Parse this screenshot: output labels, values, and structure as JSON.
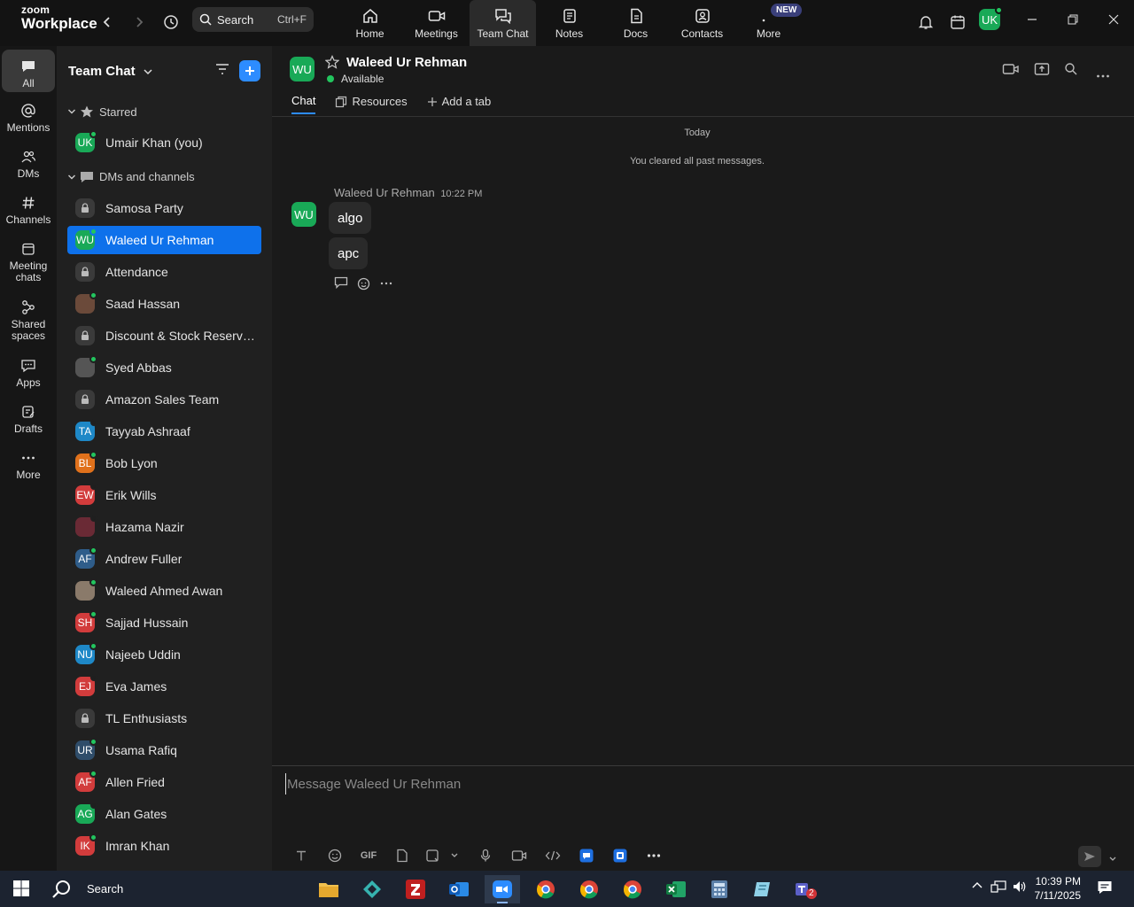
{
  "app": {
    "brand_top": "zoom",
    "brand_bottom": "Workplace"
  },
  "search": {
    "label": "Search",
    "shortcut": "Ctrl+F"
  },
  "nav_tabs": [
    {
      "label": "Home",
      "icon": "home-icon"
    },
    {
      "label": "Meetings",
      "icon": "video-icon"
    },
    {
      "label": "Team Chat",
      "icon": "chat-icon",
      "active": true
    },
    {
      "label": "Notes",
      "icon": "notes-icon"
    },
    {
      "label": "Docs",
      "icon": "docs-icon"
    },
    {
      "label": "Contacts",
      "icon": "contacts-icon"
    },
    {
      "label": "More",
      "icon": "more-icon"
    }
  ],
  "new_badge": "NEW",
  "user_avatar": "UK",
  "rail": [
    {
      "label": "All"
    },
    {
      "label": "Mentions"
    },
    {
      "label": "DMs"
    },
    {
      "label": "Channels"
    },
    {
      "label": "Meeting chats"
    },
    {
      "label": "Shared spaces"
    },
    {
      "label": "Apps"
    },
    {
      "label": "Drafts"
    },
    {
      "label": "More"
    }
  ],
  "sidebar": {
    "title": "Team Chat",
    "starred_header": "Starred",
    "dms_header": "DMs and channels",
    "starred": [
      {
        "label": "Umair Khan (you)",
        "initials": "UK",
        "color": "#19a957",
        "status": "online"
      }
    ],
    "items": [
      {
        "label": "Samosa Party",
        "type": "channel"
      },
      {
        "label": "Waleed Ur Rehman",
        "initials": "WU",
        "color": "#19a957",
        "status": "online",
        "active": true
      },
      {
        "label": "Attendance",
        "type": "channel"
      },
      {
        "label": "Saad Hassan",
        "initials": "",
        "color": "#6b4a3a",
        "status": "online",
        "photo": true
      },
      {
        "label": "Discount & Stock Reservati...",
        "type": "channel"
      },
      {
        "label": "Syed Abbas",
        "initials": "",
        "color": "#555555",
        "status": "online",
        "photo": true
      },
      {
        "label": "Amazon Sales Team",
        "type": "channel"
      },
      {
        "label": "Tayyab Ashraaf",
        "initials": "TA",
        "color": "#1e88c7",
        "status": "away"
      },
      {
        "label": "Bob Lyon",
        "initials": "BL",
        "color": "#e0711b",
        "status": "online"
      },
      {
        "label": "Erik Wills",
        "initials": "EW",
        "color": "#d23c3c",
        "status": "away"
      },
      {
        "label": "Hazama Nazir",
        "initials": "",
        "color": "#6a2a35",
        "status": "away",
        "photo": true
      },
      {
        "label": "Andrew Fuller",
        "initials": "AF",
        "color": "#2f5d8a",
        "status": "online"
      },
      {
        "label": "Waleed Ahmed Awan",
        "initials": "",
        "color": "#8a7a6a",
        "status": "online",
        "photo": true
      },
      {
        "label": "Sajjad Hussain",
        "initials": "SH",
        "color": "#d23c3c",
        "status": "online"
      },
      {
        "label": "Najeeb Uddin",
        "initials": "NU",
        "color": "#1e88c7",
        "status": "online"
      },
      {
        "label": "Eva James",
        "initials": "EJ",
        "color": "#d23c3c",
        "status": "away"
      },
      {
        "label": "TL Enthusiasts",
        "type": "channel"
      },
      {
        "label": "Usama Rafiq",
        "initials": "UR",
        "color": "#2f4d6a",
        "status": "online"
      },
      {
        "label": "Allen Fried",
        "initials": "AF",
        "color": "#d23c3c",
        "status": "online"
      },
      {
        "label": "Alan Gates",
        "initials": "AG",
        "color": "#19a957",
        "status": "away"
      },
      {
        "label": "Imran Khan",
        "initials": "IK",
        "color": "#d23c3c",
        "status": "online"
      }
    ]
  },
  "chat": {
    "name": "Waleed Ur Rehman",
    "initials": "WU",
    "status": "Available",
    "tabs": [
      "Chat",
      "Resources",
      "Add a tab"
    ],
    "date_divider": "Today",
    "system_note": "You cleared all past messages.",
    "message": {
      "sender": "Waleed Ur Rehman",
      "time": "10:22 PM",
      "bubbles": [
        "algo",
        "apc"
      ]
    }
  },
  "composer": {
    "placeholder": "Message Waleed Ur Rehman",
    "gif_label": "GIF"
  },
  "taskbar": {
    "search_label": "Search",
    "time": "10:39 PM",
    "date": "7/11/2025",
    "teams_badge": "2"
  },
  "colors": {
    "accent": "#0e71eb",
    "online": "#22c55e",
    "avatar_green": "#19a957"
  }
}
